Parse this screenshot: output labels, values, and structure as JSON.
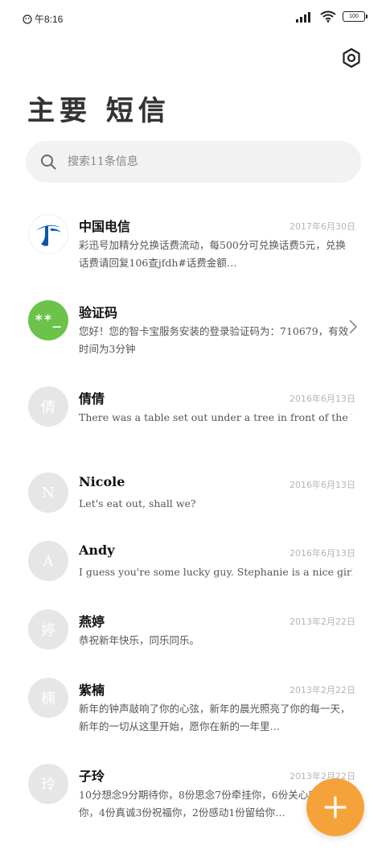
{
  "status": {
    "time": "午8:16",
    "battery": "100",
    "icons": [
      "bug-icon",
      "signal-icon",
      "wifi-icon",
      "battery-icon"
    ]
  },
  "header": {
    "title": "主要 短信",
    "settings_icon": "hexagon-settings-icon"
  },
  "search": {
    "placeholder": "搜索11条信息"
  },
  "conversations": [
    {
      "name": "中国电信",
      "date": "2017年6月30日",
      "preview": "彩迅号加精分兑换话费流动，每500分可兑换话费5元，兑换话费请回复106查jfdh#话费金额…",
      "avatar_type": "telecom-logo"
    },
    {
      "name": "验证码",
      "date": "",
      "preview": "您好！您的智卡宝服务安装的登录验证码为：710679，有效时间为3分钟",
      "avatar_type": "code-badge",
      "avatar_text": "**_"
    },
    {
      "name": "倩倩",
      "date": "2016年6月13日",
      "preview": "There was a table set out under a tree in front of the hous",
      "avatar_type": "letter",
      "avatar_text": "倩"
    },
    {
      "name": "Nicole",
      "date": "2016年6月13日",
      "preview": "Let's eat out, shall we?",
      "avatar_type": "letter",
      "avatar_text": "N"
    },
    {
      "name": "Andy",
      "date": "2016年6月13日",
      "preview": "I guess you're some lucky guy. Stephanie is a nice girl.",
      "avatar_type": "letter",
      "avatar_text": "A"
    },
    {
      "name": "燕婷",
      "date": "2013年2月22日",
      "preview": "恭祝新年快乐，同乐同乐。",
      "avatar_type": "letter",
      "avatar_text": "婷"
    },
    {
      "name": "紫楠",
      "date": "2013年2月22日",
      "preview": "新年的钟声敲响了你的心弦，新年的晨光照亮了你的每一天，新年的一切从这里开始，愿你在新的一年里…",
      "avatar_type": "letter",
      "avatar_text": "楠"
    },
    {
      "name": "子玲",
      "date": "2013年2月22日",
      "preview": "10分想念9分期待你，8份思念7份牵挂你，6份关心5份爱你，4份真诚3份祝福你，2份感动1份留给你…",
      "avatar_type": "letter",
      "avatar_text": "玲"
    }
  ],
  "fab": {
    "icon": "plus-icon",
    "color": "#f6a23a"
  },
  "colors": {
    "accent": "#f6a23a",
    "telecom_blue": "#0a58a8",
    "code_green": "#6cc24a",
    "avatar_grey": "#e6e6e6",
    "search_bg": "#f2f2f2"
  }
}
